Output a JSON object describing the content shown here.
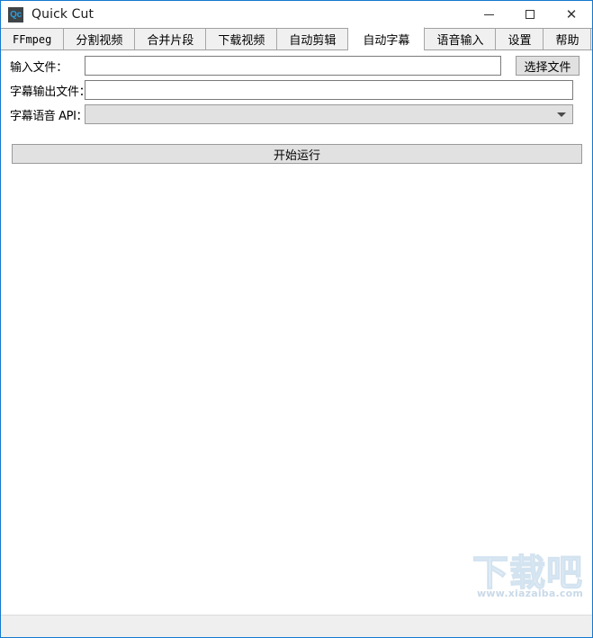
{
  "window": {
    "title": "Quick Cut",
    "icon_label": "Qc",
    "accent_color": "#1578cf",
    "controls": {
      "minimize": "minimize-icon",
      "maximize": "maximize-icon",
      "close": "close-icon"
    }
  },
  "tabs": [
    {
      "label": "FFmpeg",
      "active": false
    },
    {
      "label": "分割视频",
      "active": false
    },
    {
      "label": "合并片段",
      "active": false
    },
    {
      "label": "下载视频",
      "active": false
    },
    {
      "label": "自动剪辑",
      "active": false
    },
    {
      "label": "自动字幕",
      "active": true
    },
    {
      "label": "语音输入",
      "active": false
    },
    {
      "label": "设置",
      "active": false
    },
    {
      "label": "帮助",
      "active": false
    }
  ],
  "form": {
    "input_file": {
      "label": "输入文件：",
      "value": "",
      "placeholder": ""
    },
    "subtitle_output_file": {
      "label": "字幕输出文件：",
      "value": "",
      "placeholder": ""
    },
    "subtitle_speech_api": {
      "label": "字幕语音 API：",
      "value": "",
      "options": []
    },
    "choose_file_button": "选择文件",
    "run_button": "开始运行"
  },
  "watermark": {
    "main": "下载吧",
    "url": "www.xiazaiba.com"
  }
}
